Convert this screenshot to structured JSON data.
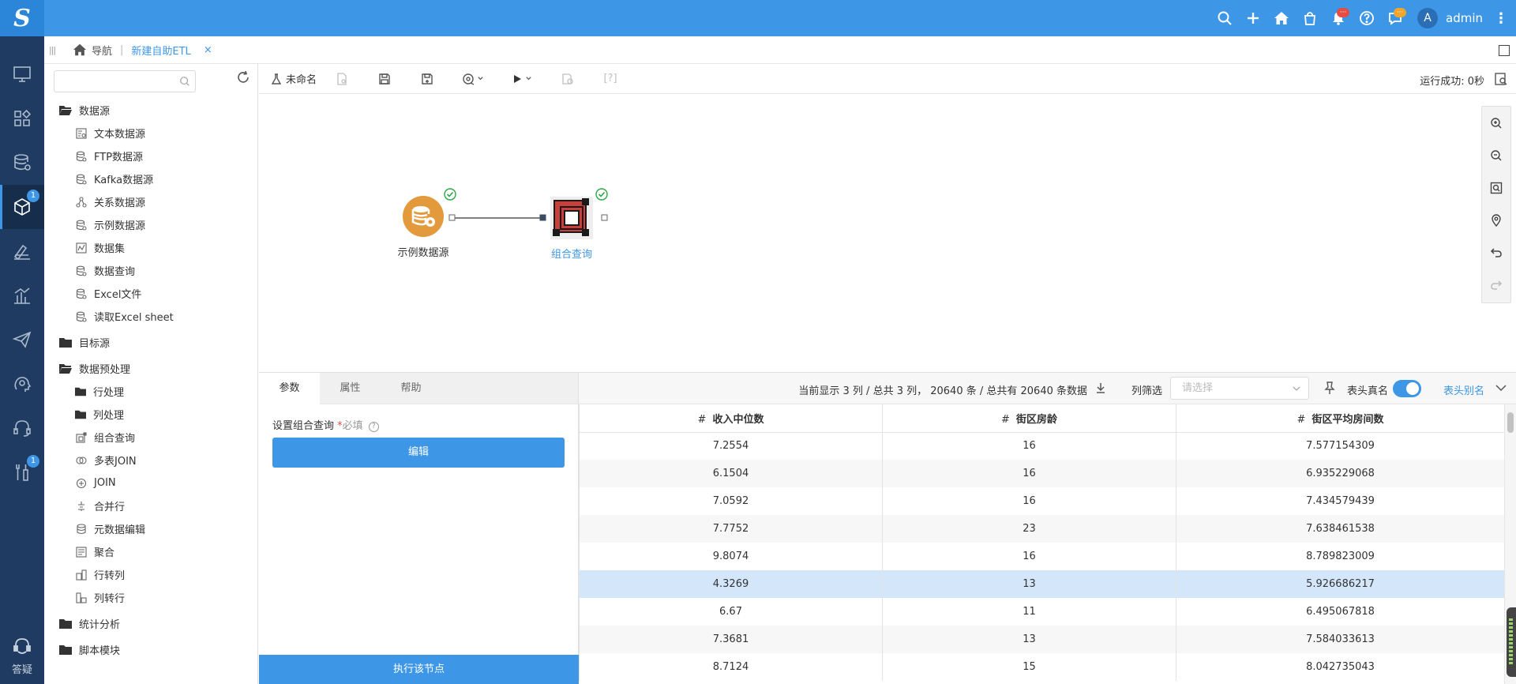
{
  "app": {
    "logo_letter": "S"
  },
  "topbar": {
    "notification_badge": "···",
    "message_badge": "···",
    "avatar_letter": "A",
    "username": "admin"
  },
  "leftnav": {
    "badge_etl": "1",
    "badge_tools": "1",
    "help_label": "答疑"
  },
  "breadcrumb": {
    "home_label": "导航",
    "tab_label": "新建自助ETL",
    "close": "×"
  },
  "tree": {
    "search_placeholder": "",
    "groups": [
      {
        "label": "数据源",
        "icon": "folder-open-icon",
        "items": [
          {
            "label": "文本数据源",
            "icon": "text-file-icon"
          },
          {
            "label": "FTP数据源",
            "icon": "database-icon"
          },
          {
            "label": "Kafka数据源",
            "icon": "database-icon"
          },
          {
            "label": "关系数据源",
            "icon": "relation-icon"
          },
          {
            "label": "示例数据源",
            "icon": "database-icon"
          },
          {
            "label": "数据集",
            "icon": "dataset-icon"
          },
          {
            "label": "数据查询",
            "icon": "database-icon"
          },
          {
            "label": "Excel文件",
            "icon": "database-icon"
          },
          {
            "label": "读取Excel sheet",
            "icon": "database-icon"
          }
        ]
      },
      {
        "label": "目标源",
        "icon": "folder-icon",
        "items": []
      },
      {
        "label": "数据预处理",
        "icon": "folder-open-icon",
        "items": [
          {
            "label": "行处理",
            "icon": "folder-icon"
          },
          {
            "label": "列处理",
            "icon": "folder-icon"
          },
          {
            "label": "组合查询",
            "icon": "combine-icon"
          },
          {
            "label": "多表JOIN",
            "icon": "multi-join-icon"
          },
          {
            "label": "JOIN",
            "icon": "join-icon"
          },
          {
            "label": "合并行",
            "icon": "merge-rows-icon"
          },
          {
            "label": "元数据编辑",
            "icon": "metadata-icon"
          },
          {
            "label": "聚合",
            "icon": "aggregate-icon"
          },
          {
            "label": "行转列",
            "icon": "row-to-col-icon"
          },
          {
            "label": "列转行",
            "icon": "col-to-row-icon"
          }
        ]
      },
      {
        "label": "统计分析",
        "icon": "folder-icon",
        "items": []
      },
      {
        "label": "脚本模块",
        "icon": "folder-icon",
        "items": []
      }
    ]
  },
  "toolbar": {
    "name_label": "未命名",
    "status": "运行成功: 0秒"
  },
  "canvas": {
    "node_source_label": "示例数据源",
    "node_combine_label": "组合查询"
  },
  "config": {
    "tab_params": "参数",
    "tab_props": "属性",
    "tab_help": "帮助",
    "field_label": "设置组合查询",
    "required_mark": "*",
    "required_text": "必填",
    "help_mark": "?",
    "edit_button": "编辑",
    "run_node_button": "执行该节点"
  },
  "preview": {
    "info": "当前显示 3 列 / 总共 3 列，  20640 条 / 总共有 20640 条数据",
    "filter_label": "列筛选",
    "filter_placeholder": "请选择",
    "real_name_label": "表头真名",
    "alias_label": "表头别名",
    "header_real_name_on": true,
    "hash": "#",
    "columns": [
      "收入中位数",
      "街区房龄",
      "街区平均房间数"
    ],
    "rows": [
      [
        "7.2554",
        "16",
        "7.577154309"
      ],
      [
        "6.1504",
        "16",
        "6.935229068"
      ],
      [
        "7.0592",
        "16",
        "7.434579439"
      ],
      [
        "7.7752",
        "23",
        "7.638461538"
      ],
      [
        "9.8074",
        "16",
        "8.789823009"
      ],
      [
        "4.3269",
        "13",
        "5.926686217"
      ],
      [
        "6.67",
        "11",
        "6.495067818"
      ],
      [
        "7.3681",
        "13",
        "7.584033613"
      ],
      [
        "8.7124",
        "15",
        "8.042735043"
      ]
    ],
    "selected_row": 5
  },
  "colors": {
    "primary": "#3e96e6",
    "nav_bg": "#1f3b61",
    "source_node": "#e39a3c",
    "combine_node": "#c9403b",
    "success": "#2aa845"
  }
}
